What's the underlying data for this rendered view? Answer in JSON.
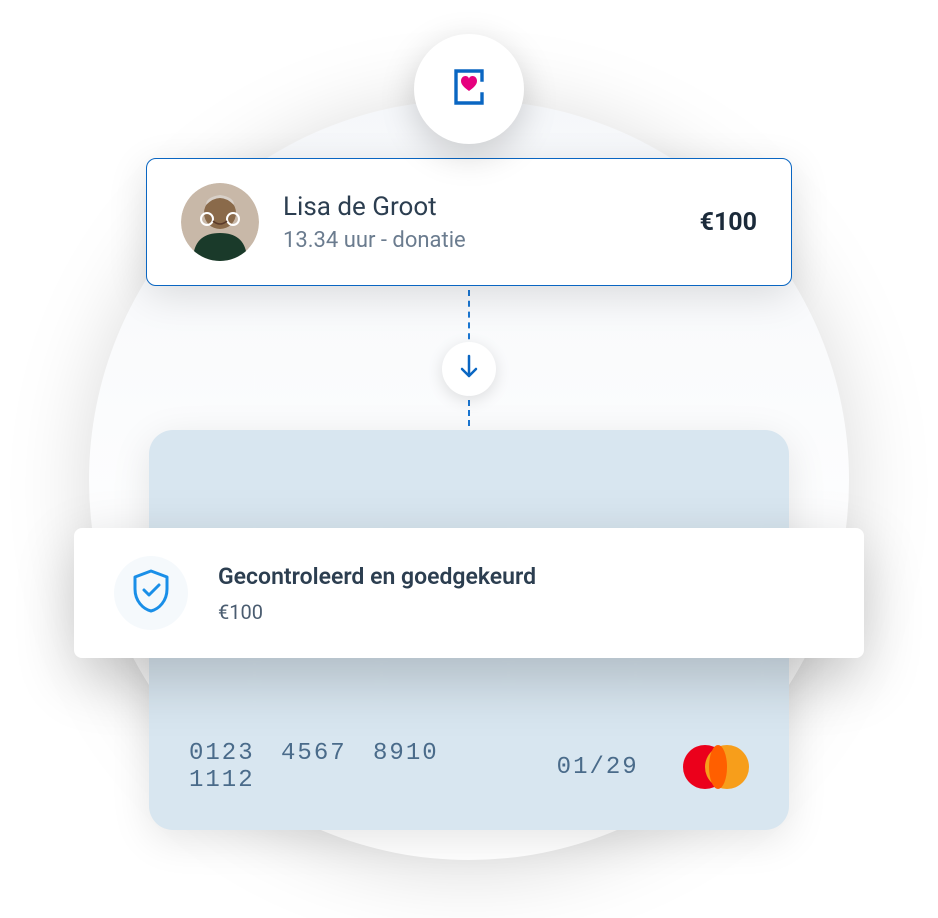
{
  "donation": {
    "name": "Lisa de Groot",
    "meta": "13.34 uur - donatie",
    "amount": "€100"
  },
  "approval": {
    "title": "Gecontroleerd en goedgekeurd",
    "amount": "€100"
  },
  "card": {
    "number": "0123 4567 8910 1112",
    "expiry": "01/29"
  }
}
